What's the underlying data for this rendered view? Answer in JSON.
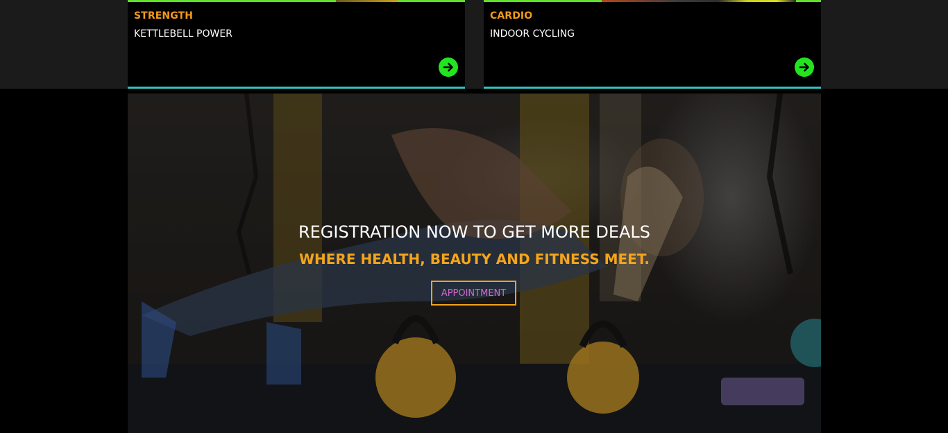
{
  "classes": [
    {
      "category": "STRENGTH",
      "title": "KETTLEBELL POWER",
      "arrow_icon": "arrow-right-circle-icon"
    },
    {
      "category": "CARDIO",
      "title": "INDOOR CYCLING",
      "arrow_icon": "arrow-right-circle-icon"
    }
  ],
  "banner": {
    "headline": "REGISTRATION NOW TO GET MORE DEALS",
    "subheadline": "WHERE HEALTH, BEAUTY AND FITNESS MEET.",
    "cta_label": "APPOINTMENT"
  },
  "colors": {
    "accent_orange": "#f5a51b",
    "arrow_green": "#22e51f",
    "card_top_border": "#5fe02b",
    "card_bottom_border": "#2fc6c2",
    "cta_text": "#d466d3"
  }
}
